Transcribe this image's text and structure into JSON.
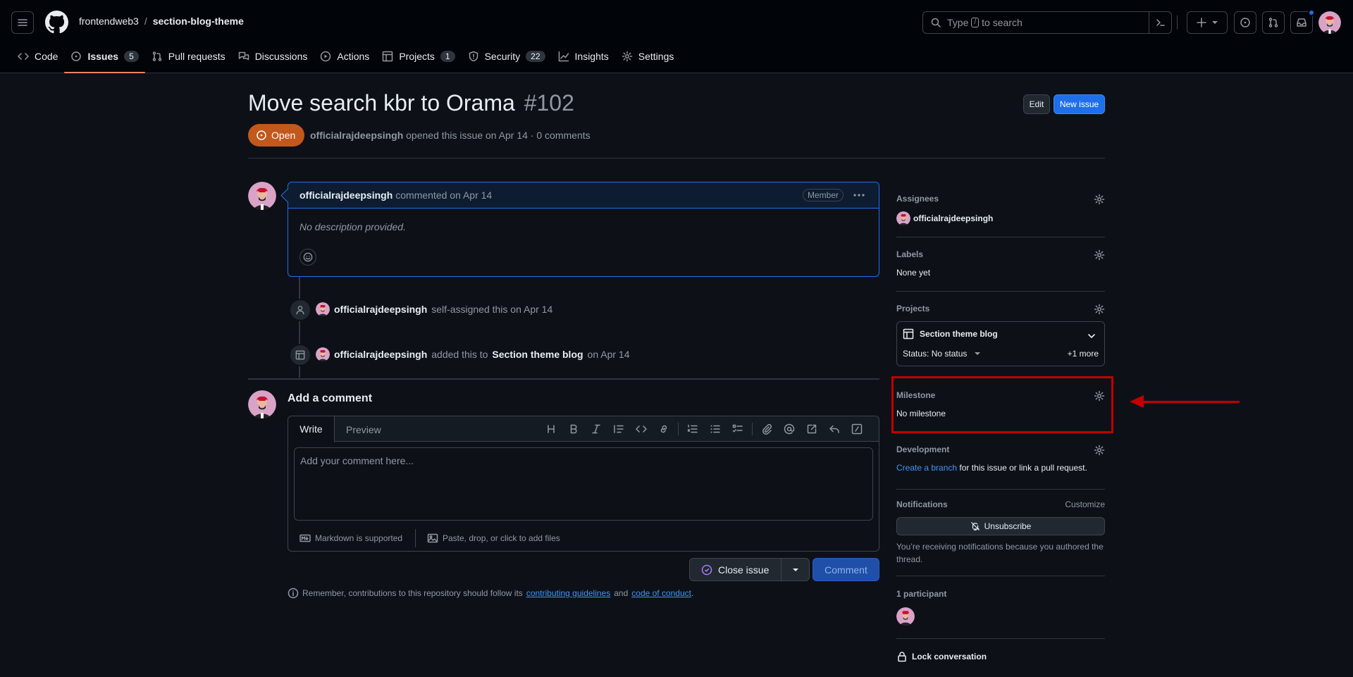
{
  "header": {
    "owner": "frontendweb3",
    "separator": "/",
    "repo": "section-blog-theme",
    "search_pre": "Type",
    "search_key": "/",
    "search_post": "to search"
  },
  "tabs": [
    {
      "label": "Code",
      "icon": "code-icon"
    },
    {
      "label": "Issues",
      "count": "5",
      "icon": "issue-opened-icon",
      "active": true
    },
    {
      "label": "Pull requests",
      "icon": "git-pull-request-icon"
    },
    {
      "label": "Discussions",
      "icon": "comment-discussion-icon"
    },
    {
      "label": "Actions",
      "icon": "play-icon"
    },
    {
      "label": "Projects",
      "count": "1",
      "icon": "table-icon"
    },
    {
      "label": "Security",
      "count": "22",
      "icon": "shield-icon"
    },
    {
      "label": "Insights",
      "icon": "graph-icon"
    },
    {
      "label": "Settings",
      "icon": "gear-icon"
    }
  ],
  "issue": {
    "title": "Move search kbr to Orama",
    "number": "#102",
    "edit_label": "Edit",
    "new_label": "New issue",
    "state": "Open",
    "author": "officialrajdeepsingh",
    "meta_rest": "opened this issue on Apr 14 · 0 comments"
  },
  "comment": {
    "author": "officialrajdeepsingh",
    "action": "commented on Apr 14",
    "badge": "Member",
    "body": "No description provided."
  },
  "events": [
    {
      "actor": "officialrajdeepsingh",
      "text": "self-assigned this on Apr 14",
      "icon": "person-icon"
    },
    {
      "actor": "officialrajdeepsingh",
      "text_pre": "added this to",
      "target": "Section theme blog",
      "text_post": "on Apr 14",
      "icon": "table-icon"
    }
  ],
  "composer": {
    "title": "Add a comment",
    "tab_write": "Write",
    "tab_preview": "Preview",
    "placeholder": "Add your comment here...",
    "markdown_note": "Markdown is supported",
    "paste_note": "Paste, drop, or click to add files",
    "close_label": "Close issue",
    "comment_label": "Comment",
    "remember_pre": "Remember, contributions to this repository should follow its",
    "guidelines_link": "contributing guidelines",
    "and": "and",
    "conduct_link": "code of conduct",
    "period": "."
  },
  "sidebar": {
    "assignees_label": "Assignees",
    "assignee": "officialrajdeepsingh",
    "labels_label": "Labels",
    "labels_value": "None yet",
    "projects_label": "Projects",
    "project_name": "Section theme blog",
    "project_status": "Status: No status",
    "project_more": "+1 more",
    "milestone_label": "Milestone",
    "milestone_value": "No milestone",
    "development_label": "Development",
    "dev_link": "Create a branch",
    "dev_rest": "for this issue or link a pull request.",
    "notifications_label": "Notifications",
    "customize": "Customize",
    "unsubscribe": "Unsubscribe",
    "notif_reason": "You’re receiving notifications because you authored the thread.",
    "participants_label": "1 participant",
    "lock_label": "Lock conversation"
  },
  "colors": {
    "accent": "#1f6feb",
    "open_state": "#c2581c",
    "annotation": "#c00000",
    "tab_underline": "#f78166"
  }
}
